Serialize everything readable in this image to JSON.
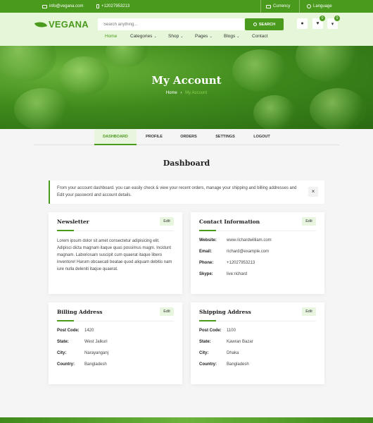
{
  "topbar": {
    "email": "info@vegana.com",
    "phone": "+12027953213",
    "currency": "Currency",
    "language": "Language"
  },
  "header": {
    "logo": "VEGANA",
    "search_placeholder": "Search anything...",
    "search_button": "SEARCH",
    "wishlist_count": "0",
    "cart_count": "0"
  },
  "nav": {
    "items": [
      "Home",
      "Categories",
      "Shop",
      "Pages",
      "Blogs",
      "Contact"
    ],
    "caret": "⌄"
  },
  "hero": {
    "title": "My Account",
    "breadcrumb_home": "Home",
    "breadcrumb_sep": "›",
    "breadcrumb_current": "My Account"
  },
  "tabs": [
    "DASHBOARD",
    "PROFILE",
    "ORDERS",
    "SETTINGS",
    "LOGOUT"
  ],
  "dashboard": {
    "title": "Dashboard",
    "notice": "From your account dashboard. you can easily check & view your recent orders, manage your shipping and billing addresses and Edit your password and account details.",
    "close": "×"
  },
  "cards": {
    "edit_label": "Edit",
    "newsletter": {
      "title": "Newsletter",
      "body": "Lorem ipsum dolor sit amet consectetur adipisicing elit. Adipisci dicta magnam itaque quas possimus magni. Incidunt magnam. Laboriosam suscipit cum quaerat itaque libero inventore! Harum obcaecati beatae quod aliquam debitis nam iure nulla deleniti itaque quaerat."
    },
    "contact": {
      "title": "Contact Information",
      "rows": [
        {
          "k": "Website:",
          "v": "www.richardwilliam.com"
        },
        {
          "k": "Email:",
          "v": "richard@example.com"
        },
        {
          "k": "Phone:",
          "v": "+12027953213"
        },
        {
          "k": "Skype:",
          "v": "live:richard"
        }
      ]
    },
    "billing": {
      "title": "Billing Address",
      "rows": [
        {
          "k": "Post Code:",
          "v": "1420"
        },
        {
          "k": "State:",
          "v": "West Jalkuri"
        },
        {
          "k": "City:",
          "v": "Narayanganj"
        },
        {
          "k": "Country:",
          "v": "Bangladesh"
        }
      ]
    },
    "shipping": {
      "title": "Shipping Address",
      "rows": [
        {
          "k": "Post Code:",
          "v": "1100"
        },
        {
          "k": "State:",
          "v": "Kawran Bazar"
        },
        {
          "k": "City:",
          "v": "Dhaka"
        },
        {
          "k": "Country:",
          "v": "Bangladesh"
        }
      ]
    }
  },
  "colors": {
    "brand": "#4a9a1e",
    "header_bg": "#e6f7d9"
  }
}
